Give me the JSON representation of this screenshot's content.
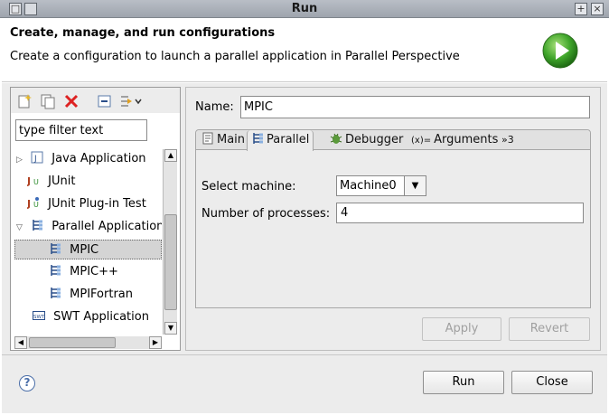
{
  "window": {
    "title": "Run",
    "buttons": {
      "maximize": "+",
      "close": "×",
      "menu": "□"
    }
  },
  "header": {
    "title": "Create, manage, and run configurations",
    "message": "Create a configuration to launch a parallel application in Parallel Perspective"
  },
  "sidebar": {
    "toolbar": [
      "new-config-icon",
      "duplicate-icon",
      "delete-icon",
      "collapse-all-icon",
      "filter-icon"
    ],
    "filter_placeholder": "type filter text",
    "tree": [
      {
        "label": "Java Application",
        "icon": "java-app-icon",
        "expander": "▷"
      },
      {
        "label": "JUnit",
        "icon": "junit-icon"
      },
      {
        "label": "JUnit Plug-in Test",
        "icon": "junit-plugin-icon"
      },
      {
        "label": "Parallel Application",
        "icon": "parallel-app-icon",
        "expander": "▽"
      },
      {
        "label": "MPIC",
        "icon": "parallel-app-icon",
        "selected": true
      },
      {
        "label": "MPIC++",
        "icon": "parallel-app-icon"
      },
      {
        "label": "MPIFortran",
        "icon": "parallel-app-icon"
      },
      {
        "label": "SWT Application",
        "icon": "swt-icon"
      }
    ]
  },
  "config": {
    "name_label": "Name:",
    "name_value": "MPIC",
    "tabs": [
      {
        "label": "Main",
        "icon": "main-tab-icon"
      },
      {
        "label": "Parallel",
        "icon": "parallel-app-icon",
        "active": true
      },
      {
        "label": "Debugger",
        "icon": "bug-icon"
      },
      {
        "label": "Arguments",
        "icon": "arguments-icon"
      },
      {
        "label": "»3",
        "icon": ""
      }
    ],
    "parallel": {
      "machine_label": "Select machine:",
      "machine_value": "Machine0",
      "processes_label": "Number of processes:",
      "processes_value": "4"
    },
    "apply_label": "Apply",
    "revert_label": "Revert"
  },
  "footer": {
    "help_icon": "?",
    "run_label": "Run",
    "close_label": "Close"
  }
}
